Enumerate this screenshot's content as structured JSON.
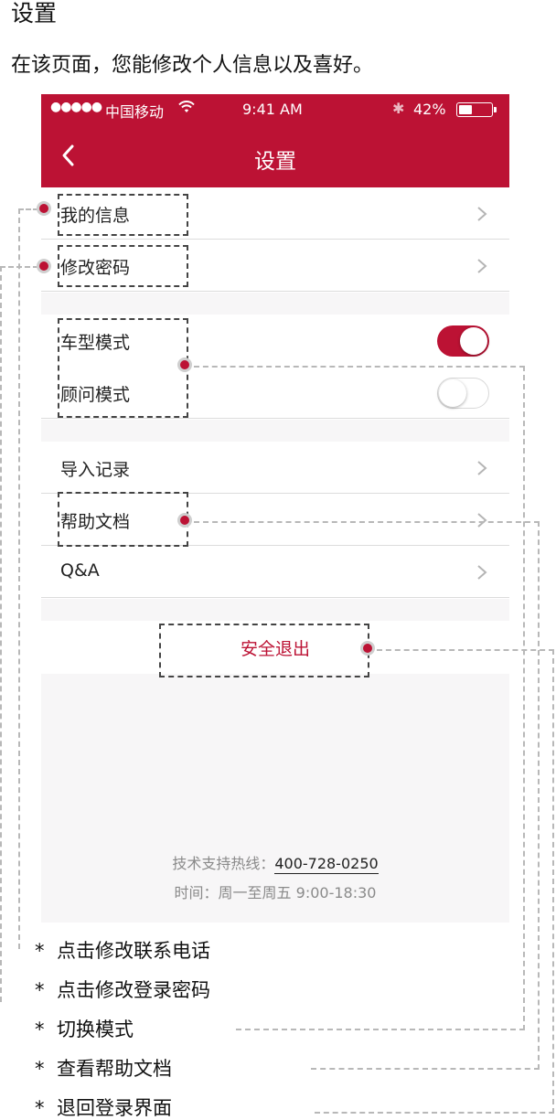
{
  "page": {
    "title": "设置",
    "description": "在该页面，您能修改个人信息以及喜好。"
  },
  "status_bar": {
    "signal": "●●●●●",
    "carrier": "中国移动",
    "time": "9:41 AM",
    "battery": "42%",
    "battery_level": 0.42
  },
  "nav": {
    "title": "设置"
  },
  "groups": {
    "account": [
      "我的信息",
      "修改密码"
    ],
    "modes": [
      {
        "label": "车型模式",
        "on": true
      },
      {
        "label": "顾问模式",
        "on": false
      }
    ],
    "misc": [
      "导入记录",
      "帮助文档",
      "Q&A"
    ]
  },
  "logout": "安全退出",
  "footer": {
    "hotline_label": "技术支持热线：",
    "hotline_number": "400-728-0250",
    "hours": "时间：周一至周五 9:00-18:30"
  },
  "notes": [
    "点击修改联系电话",
    "点击修改登录密码",
    "切换模式",
    "查看帮助文档",
    "退回登录界面"
  ],
  "colors": {
    "brand": "#bc1234",
    "background_gray": "#f7f6f7",
    "annotation_line": "#b8b8b8"
  }
}
